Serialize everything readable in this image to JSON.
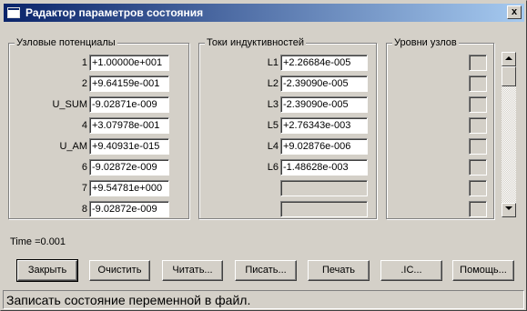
{
  "window": {
    "title": "Радактор параметров состояния",
    "close_label": "x"
  },
  "node_potentials": {
    "legend": "Узловые потенциалы",
    "rows": [
      {
        "label": "1",
        "value": "+1.00000e+001"
      },
      {
        "label": "2",
        "value": "+9.64159e-001"
      },
      {
        "label": "U_SUM",
        "value": "-9.02871e-009"
      },
      {
        "label": "4",
        "value": "+3.07978e-001"
      },
      {
        "label": "U_AM",
        "value": "+9.40931e-015"
      },
      {
        "label": "6",
        "value": "-9.02872e-009"
      },
      {
        "label": "7",
        "value": "+9.54781e+000"
      },
      {
        "label": "8",
        "value": "-9.02872e-009"
      }
    ]
  },
  "inductor_currents": {
    "legend": "Токи индуктивностей",
    "rows": [
      {
        "label": "L1",
        "value": "+2.26684e-005"
      },
      {
        "label": "L2",
        "value": "-2.39090e-005"
      },
      {
        "label": "L3",
        "value": "-2.39090e-005"
      },
      {
        "label": "L5",
        "value": "+2.76343e-003"
      },
      {
        "label": "L4",
        "value": "+9.02876e-006"
      },
      {
        "label": "L6",
        "value": "-1.48628e-003"
      },
      {
        "label": "",
        "value": ""
      },
      {
        "label": "",
        "value": ""
      }
    ]
  },
  "node_levels": {
    "legend": "Уровни узлов",
    "count": 8
  },
  "time_label": "Time =0.001",
  "buttons": {
    "close": "Закрыть",
    "clear": "Очистить",
    "read": "Читать...",
    "write": "Писать...",
    "print": "Печать",
    "ic": ".IC...",
    "help": "Помощь..."
  },
  "status_text": "Записать состояние переменной в файл."
}
